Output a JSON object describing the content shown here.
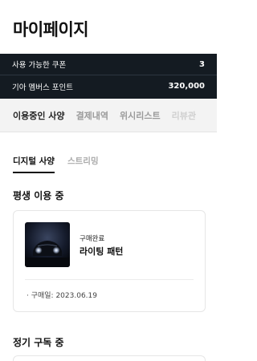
{
  "header": {
    "title": "마이페이지"
  },
  "benefits": {
    "coupon_label": "사용 가능한 쿠폰",
    "coupon_value": "3",
    "points_label": "기아 멤버스 포인트",
    "points_value": "320,000"
  },
  "tabs": [
    {
      "label": "이용중인 사양"
    },
    {
      "label": "결제내역"
    },
    {
      "label": "위시리스트"
    },
    {
      "label": "리뷰관"
    }
  ],
  "subtabs": [
    {
      "label": "디지털 사양"
    },
    {
      "label": "스트리밍"
    }
  ],
  "lifetime": {
    "title": "평생 이용 중",
    "item": {
      "status": "구매완료",
      "name": "라이팅 패턴",
      "date": "· 구매일: 2023.06.19"
    }
  },
  "subscription": {
    "title": "정기 구독 중"
  },
  "colors": {
    "dark_panel": "#141b22",
    "tabbar_bg": "#f3f3f3"
  }
}
